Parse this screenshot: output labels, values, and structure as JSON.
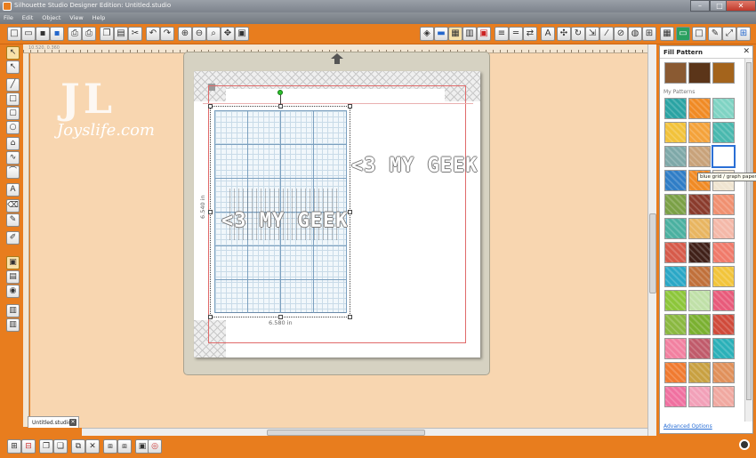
{
  "window": {
    "title": "Silhouette Studio Designer Edition: Untitled.studio",
    "buttons": {
      "minimize": "–",
      "maximize": "□",
      "close": "✕"
    }
  },
  "menu": [
    "File",
    "Edit",
    "Object",
    "View",
    "Help"
  ],
  "toolbar": {
    "left": [
      "new-icon",
      "open-icon",
      "save-icon",
      "save-to-library-icon",
      "print-icon",
      "print-cut-icon",
      "copy-icon",
      "paste-icon",
      "cut-icon",
      "undo-icon",
      "redo-icon",
      "zoom-in-icon",
      "zoom-out-icon",
      "zoom-select-icon",
      "pan-icon",
      "fit-page-icon"
    ],
    "right": [
      "fill-color-icon",
      "line-color-icon",
      "fill-pattern-icon",
      "fill-gradient-icon",
      "line-style-icon",
      "line-weight-icon",
      "transform-icon",
      "text-style-icon",
      "align-icon",
      "replicate-icon",
      "rotate-icon",
      "scale-icon",
      "move-icon",
      "weld-icon",
      "offset-icon",
      "trace-icon",
      "knife-icon",
      "eraser-icon",
      "page-setup-icon",
      "cut-settings-icon",
      "fullscreen-icon",
      "grid-icon"
    ]
  },
  "ruler": {
    "corner_label": "10.520, 0.360"
  },
  "tools_left": [
    "select-icon",
    "point-edit-icon",
    "line-icon",
    "rectangle-icon",
    "rounded-rect-icon",
    "ellipse-icon",
    "polygon-icon",
    "curve-icon",
    "arc-icon",
    "freehand-icon",
    "text-icon",
    "eraser-icon",
    "knife-icon",
    "paint-icon",
    "fill-panel-icon",
    "library-icon",
    "store-icon",
    "layers-icon"
  ],
  "watermark": {
    "initials": "JL",
    "site": "Joyslife.com"
  },
  "design": {
    "text": "<3 MY GEEK",
    "dim_width": "6.580 in",
    "dim_height": "6.540 in"
  },
  "tab": {
    "label": "Untitled.studio",
    "close": "✕"
  },
  "panel": {
    "title": "Fill Pattern",
    "close": "✕",
    "section": "My Patterns",
    "tooltip": "blue grid / graph paper",
    "advanced": "Advanced Options",
    "swatch_colors": {
      "top": [
        "#8a5a32",
        "#5b3519",
        "#a4641c"
      ],
      "rows": [
        [
          "#2aa3a3",
          "#f08a24",
          "#7fd3c3"
        ],
        [
          "#f2c23a",
          "#f4a23a",
          "#49b8ae"
        ],
        [
          "#7ea8a8",
          "#c8a27a",
          "#ffffff"
        ],
        [
          "#2f7dc6",
          "#f08a24",
          "#efe4d0"
        ],
        [
          "#7aa046",
          "#8a3b2c",
          "#f09070"
        ],
        [
          "#4ab0a0",
          "#e8b560",
          "#f4b8a8"
        ],
        [
          "#d65a4a",
          "#402018",
          "#f07a6a"
        ],
        [
          "#2aa7c6",
          "#c0703a",
          "#f2c43a"
        ],
        [
          "#8cc63a",
          "#c0e0a8",
          "#e85a7a"
        ],
        [
          "#8ab840",
          "#7ab030",
          "#d04a3a"
        ],
        [
          "#f280a0",
          "#c05a6a",
          "#2ab0b8"
        ],
        [
          "#f07a30",
          "#c8a040",
          "#e0905a"
        ],
        [
          "#f070a0",
          "#f2a0b8",
          "#f0a8a0"
        ]
      ]
    }
  }
}
